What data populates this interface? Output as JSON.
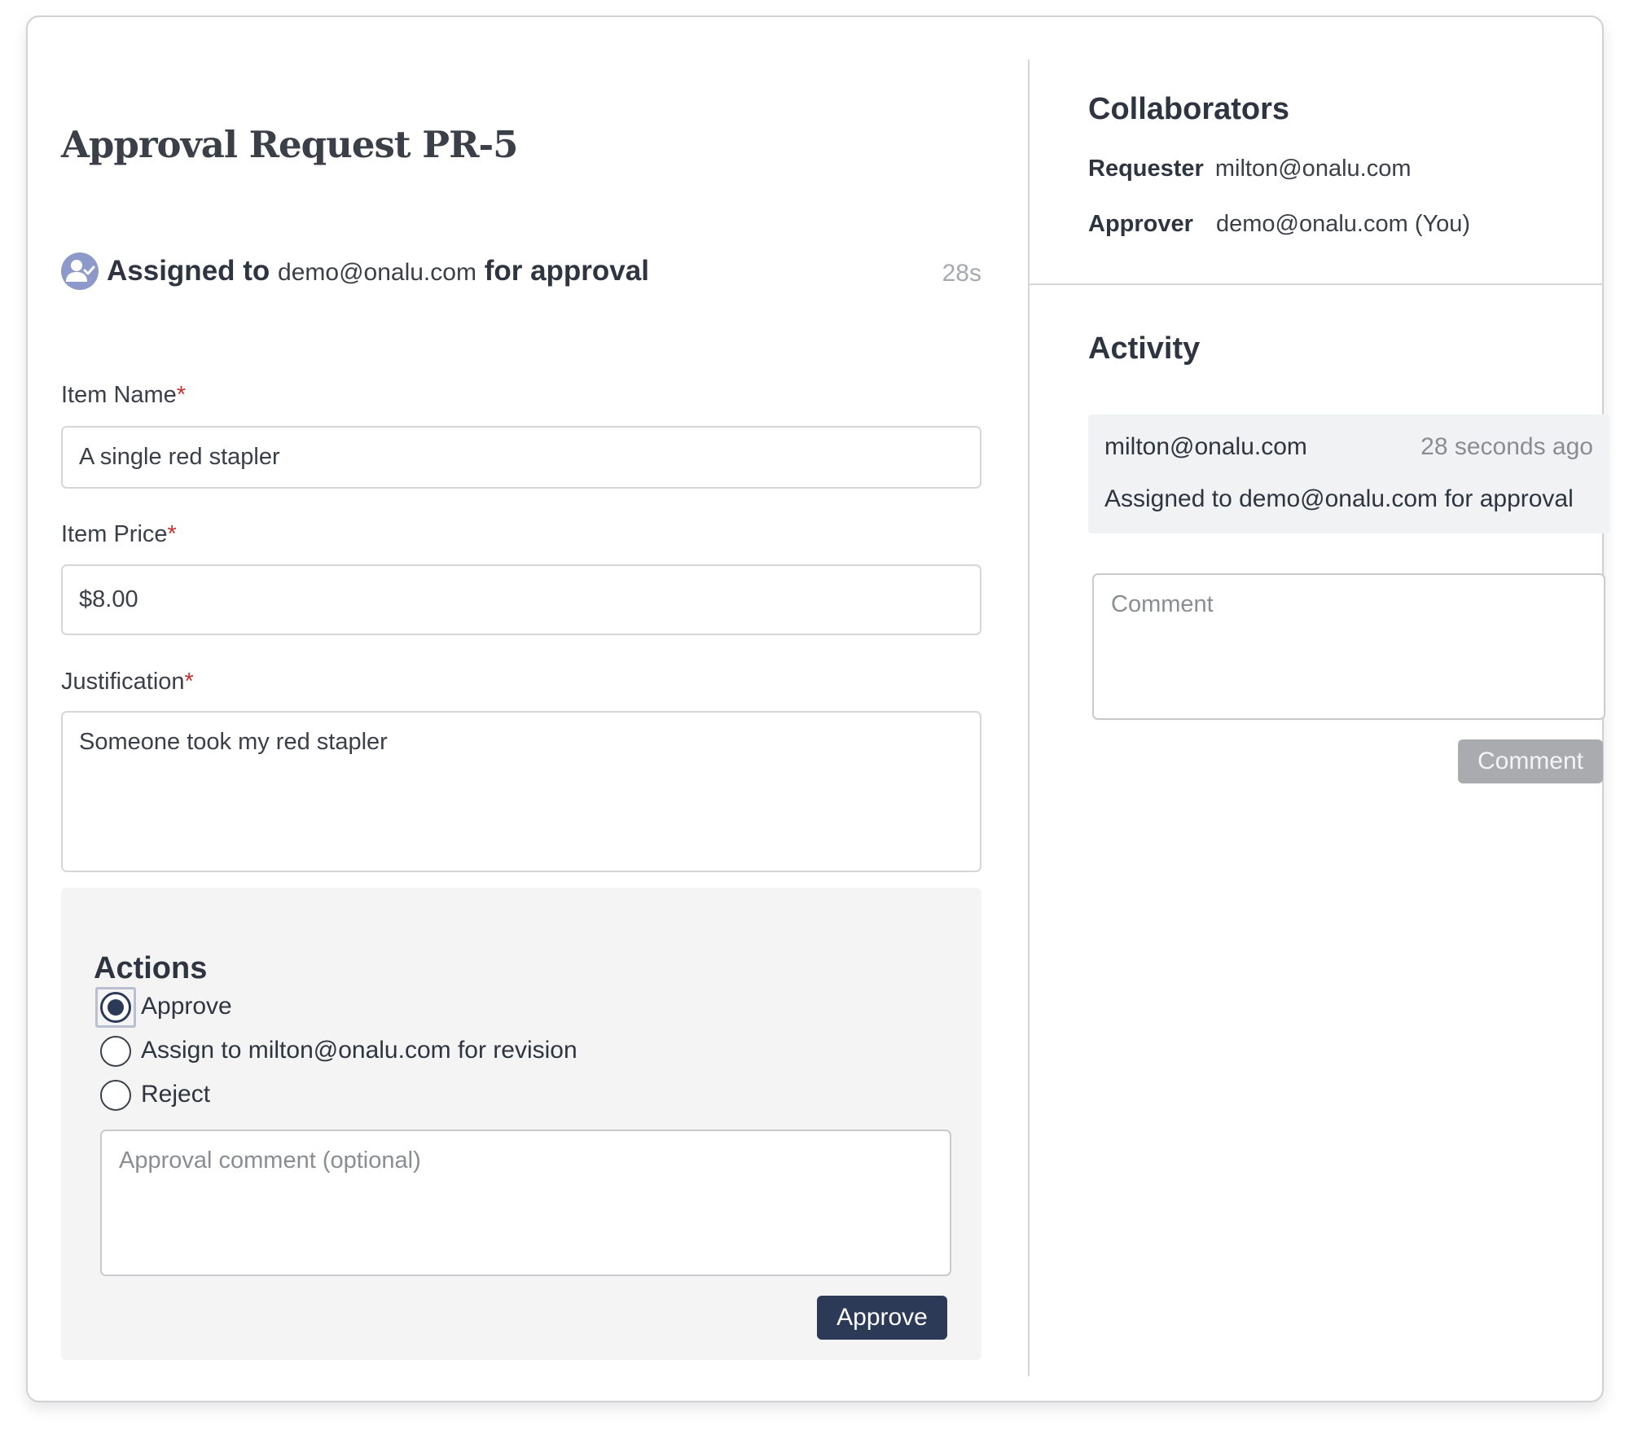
{
  "request": {
    "title": "Approval Request PR-5"
  },
  "assignment": {
    "prefix": "Assigned to",
    "email": "demo@onalu.com",
    "suffix": "for approval",
    "time": "28s"
  },
  "form": {
    "required_marker": "*",
    "item_name": {
      "label": "Item Name",
      "value": "A single red stapler"
    },
    "item_price": {
      "label": "Item Price",
      "value": "$8.00"
    },
    "justification": {
      "label": "Justification",
      "value": "Someone took my red stapler"
    }
  },
  "actions": {
    "title": "Actions",
    "options": [
      {
        "label": "Approve",
        "checked": true
      },
      {
        "label": "Assign to milton@onalu.com for revision",
        "checked": false
      },
      {
        "label": "Reject",
        "checked": false
      }
    ],
    "comment_placeholder": "Approval comment (optional)",
    "submit_label": "Approve"
  },
  "collaborators": {
    "title": "Collaborators",
    "requester_label": "Requester",
    "requester": "milton@onalu.com",
    "approver_label": "Approver",
    "approver": "demo@onalu.com (You)"
  },
  "activity": {
    "title": "Activity",
    "entries": [
      {
        "author": "milton@onalu.com",
        "time": "28 seconds ago",
        "text": "Assigned to demo@onalu.com for approval"
      }
    ],
    "comment_placeholder": "Comment",
    "comment_button": "Comment"
  },
  "colors": {
    "primary_button": "#2c3a57",
    "disabled_button": "#a9abae",
    "required": "#c53030",
    "avatar": "#8d9ac9"
  },
  "icons": {
    "assignee": "user-check-icon"
  }
}
